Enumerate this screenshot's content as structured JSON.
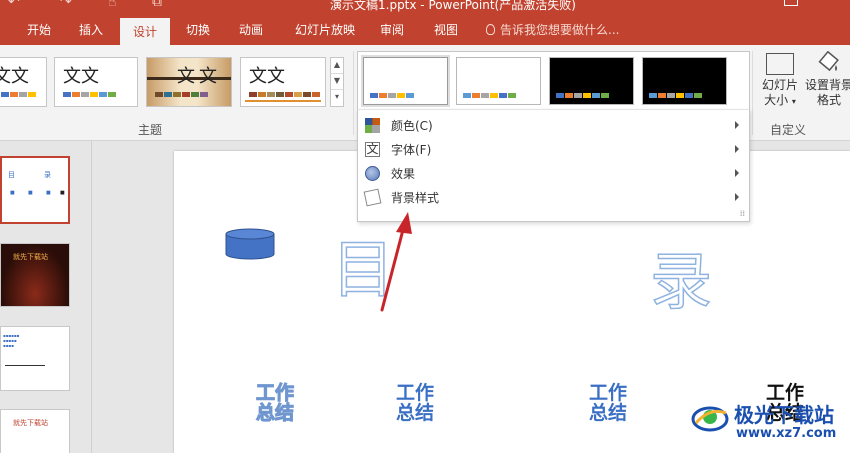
{
  "titlebar": {
    "title": "演示文稿1.pptx - PowerPoint(产品激活失败)"
  },
  "tabs": [
    {
      "label": "开始"
    },
    {
      "label": "插入"
    },
    {
      "label": "设计",
      "active": true
    },
    {
      "label": "切换"
    },
    {
      "label": "动画"
    },
    {
      "label": "幻灯片放映"
    },
    {
      "label": "审阅"
    },
    {
      "label": "视图"
    }
  ],
  "tell_me": {
    "placeholder": "告诉我您想要做什么..."
  },
  "ribbon": {
    "themes": {
      "group_label": "主题",
      "thumbs": [
        {
          "text": "文文"
        },
        {
          "text": "文文"
        },
        {
          "text": "文文"
        },
        {
          "text": "文文"
        }
      ]
    },
    "custom": {
      "group_label": "自定义",
      "slide_size": "幻灯片大小",
      "format_background": "设置背景格式"
    }
  },
  "variant_menu": {
    "items": [
      {
        "label": "颜色(C)"
      },
      {
        "label": "字体(F)"
      },
      {
        "label": "效果"
      },
      {
        "label": "背景样式"
      }
    ]
  },
  "thumbnails": {
    "slide1": {
      "left": "目",
      "right": "录"
    },
    "slide2": {
      "title": "就先下载站"
    },
    "slide4": {
      "title": "就先下载站"
    }
  },
  "slide": {
    "big_left": "目",
    "big_right": "录",
    "word_art": [
      "工作总结",
      "工作总结",
      "工作总结",
      "工作总结"
    ]
  },
  "watermark": {
    "title": "极光下载站",
    "url": "www.xz7.com"
  },
  "colors": {
    "accent": "#c1432f",
    "ribbon_bg": "#f3f3f3",
    "theme_blue": "#3a6fc4",
    "arrow": "#c8252a"
  }
}
